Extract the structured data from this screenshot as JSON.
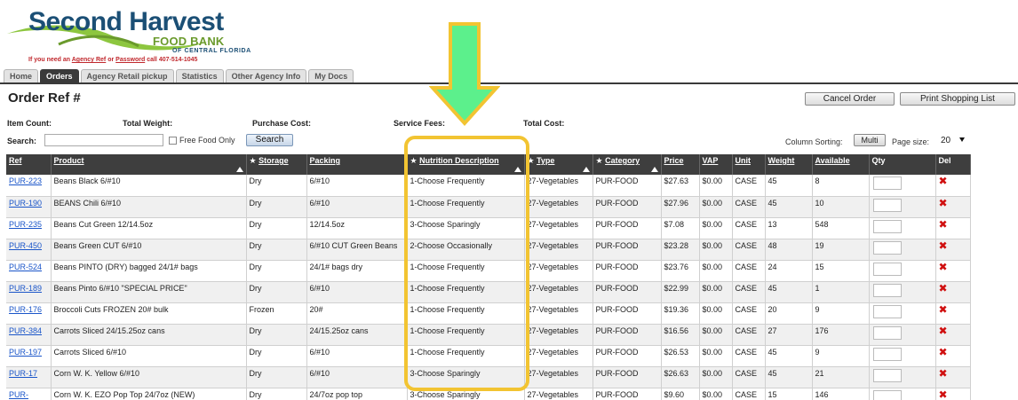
{
  "brand": {
    "line1": "Second Harvest",
    "line2": "FOOD BANK",
    "line3": "OF CENTRAL FLORIDA",
    "color_primary": "#1b4f75",
    "color_secondary": "#6a9a2c"
  },
  "help": {
    "prefix": "If you need an",
    "agency_ref": "Agency Ref",
    "or": "or",
    "password": "Password",
    "suffix": "call 407-514-1045"
  },
  "tabs": [
    {
      "label": "Home"
    },
    {
      "label": "Orders",
      "active": true
    },
    {
      "label": "Agency Retail pickup"
    },
    {
      "label": "Statistics"
    },
    {
      "label": "Other Agency Info"
    },
    {
      "label": "My Docs"
    }
  ],
  "page": {
    "title": "Order Ref #",
    "cancel_label": "Cancel Order",
    "print_label": "Print Shopping List"
  },
  "summary": {
    "item_count": "Item Count:",
    "total_weight": "Total Weight:",
    "purchase_cost": "Purchase Cost:",
    "service_fees": "Service Fees:",
    "total_cost": "Total Cost:"
  },
  "search": {
    "label": "Search:",
    "value": "",
    "free_food_label": "Free Food Only",
    "free_food_checked": false,
    "button_label": "Search"
  },
  "sorting": {
    "label": "Column Sorting:",
    "multi_label": "Multi",
    "page_size_label": "Page size:",
    "page_size_value": "20"
  },
  "columns": [
    {
      "label": "Ref",
      "starred": false,
      "sort": false
    },
    {
      "label": "Product",
      "starred": false,
      "sort": true
    },
    {
      "label": "Storage",
      "starred": true,
      "sort": false
    },
    {
      "label": "Packing",
      "starred": false,
      "sort": false
    },
    {
      "label": "Nutrition Description",
      "starred": true,
      "sort": true
    },
    {
      "label": "Type",
      "starred": true,
      "sort": true
    },
    {
      "label": "Category",
      "starred": true,
      "sort": true
    },
    {
      "label": "Price",
      "starred": false,
      "sort": false
    },
    {
      "label": "VAP",
      "starred": false,
      "sort": false
    },
    {
      "label": "Unit",
      "starred": false,
      "sort": false
    },
    {
      "label": "Weight",
      "starred": false,
      "sort": false
    },
    {
      "label": "Available",
      "starred": false,
      "sort": false
    },
    {
      "label": "Qty",
      "starred": false,
      "sort": false,
      "plain": true
    },
    {
      "label": "Del",
      "starred": false,
      "sort": false,
      "plain": true
    }
  ],
  "rows": [
    {
      "ref": "PUR-223",
      "product": "Beans Black 6/#10",
      "storage": "Dry",
      "packing": "6/#10",
      "nutrition": "1-Choose Frequently",
      "type": "27-Vegetables",
      "category": "PUR-FOOD",
      "price": "$27.63",
      "vap": "$0.00",
      "unit": "CASE",
      "weight": "45",
      "available": "8"
    },
    {
      "ref": "PUR-190",
      "product": "BEANS Chili 6/#10",
      "storage": "Dry",
      "packing": "6/#10",
      "nutrition": "1-Choose Frequently",
      "type": "27-Vegetables",
      "category": "PUR-FOOD",
      "price": "$27.96",
      "vap": "$0.00",
      "unit": "CASE",
      "weight": "45",
      "available": "10"
    },
    {
      "ref": "PUR-235",
      "product": "Beans Cut Green 12/14.5oz",
      "storage": "Dry",
      "packing": "12/14.5oz",
      "nutrition": "3-Choose Sparingly",
      "type": "27-Vegetables",
      "category": "PUR-FOOD",
      "price": "$7.08",
      "vap": "$0.00",
      "unit": "CASE",
      "weight": "13",
      "available": "548"
    },
    {
      "ref": "PUR-450",
      "product": "Beans Green CUT 6/#10",
      "storage": "Dry",
      "packing": "6/#10 CUT Green Beans",
      "nutrition": "2-Choose Occasionally",
      "type": "27-Vegetables",
      "category": "PUR-FOOD",
      "price": "$23.28",
      "vap": "$0.00",
      "unit": "CASE",
      "weight": "48",
      "available": "19"
    },
    {
      "ref": "PUR-524",
      "product": "Beans PINTO (DRY) bagged 24/1# bags",
      "storage": "Dry",
      "packing": "24/1# bags dry",
      "nutrition": "1-Choose Frequently",
      "type": "27-Vegetables",
      "category": "PUR-FOOD",
      "price": "$23.76",
      "vap": "$0.00",
      "unit": "CASE",
      "weight": "24",
      "available": "15"
    },
    {
      "ref": "PUR-189",
      "product": "Beans Pinto 6/#10 \"SPECIAL PRICE\"",
      "storage": "Dry",
      "packing": "6/#10",
      "nutrition": "1-Choose Frequently",
      "type": "27-Vegetables",
      "category": "PUR-FOOD",
      "price": "$22.99",
      "vap": "$0.00",
      "unit": "CASE",
      "weight": "45",
      "available": "1"
    },
    {
      "ref": "PUR-176",
      "product": "Broccoli Cuts FROZEN 20# bulk",
      "storage": "Frozen",
      "packing": "20#",
      "nutrition": "1-Choose Frequently",
      "type": "27-Vegetables",
      "category": "PUR-FOOD",
      "price": "$19.36",
      "vap": "$0.00",
      "unit": "CASE",
      "weight": "20",
      "available": "9"
    },
    {
      "ref": "PUR-384",
      "product": "Carrots Sliced 24/15.25oz cans",
      "storage": "Dry",
      "packing": "24/15.25oz cans",
      "nutrition": "1-Choose Frequently",
      "type": "27-Vegetables",
      "category": "PUR-FOOD",
      "price": "$16.56",
      "vap": "$0.00",
      "unit": "CASE",
      "weight": "27",
      "available": "176"
    },
    {
      "ref": "PUR-197",
      "product": "Carrots Sliced 6/#10",
      "storage": "Dry",
      "packing": "6/#10",
      "nutrition": "1-Choose Frequently",
      "type": "27-Vegetables",
      "category": "PUR-FOOD",
      "price": "$26.53",
      "vap": "$0.00",
      "unit": "CASE",
      "weight": "45",
      "available": "9"
    },
    {
      "ref": "PUR-17",
      "product": "Corn W. K. Yellow 6/#10",
      "storage": "Dry",
      "packing": "6/#10",
      "nutrition": "3-Choose Sparingly",
      "type": "27-Vegetables",
      "category": "PUR-FOOD",
      "price": "$26.63",
      "vap": "$0.00",
      "unit": "CASE",
      "weight": "45",
      "available": "21"
    },
    {
      "ref": "PUR-",
      "product": "Corn W. K. EZO Pop Top 24/7oz (NEW)",
      "storage": "Dry",
      "packing": "24/7oz pop top",
      "nutrition": "3-Choose Sparingly",
      "type": "27-Vegetables",
      "category": "PUR-FOOD",
      "price": "$9.60",
      "vap": "$0.00",
      "unit": "CASE",
      "weight": "15",
      "available": "146"
    }
  ],
  "annotation": {
    "arrow_color": "#5cf08c",
    "highlight_color": "#f2c432"
  }
}
